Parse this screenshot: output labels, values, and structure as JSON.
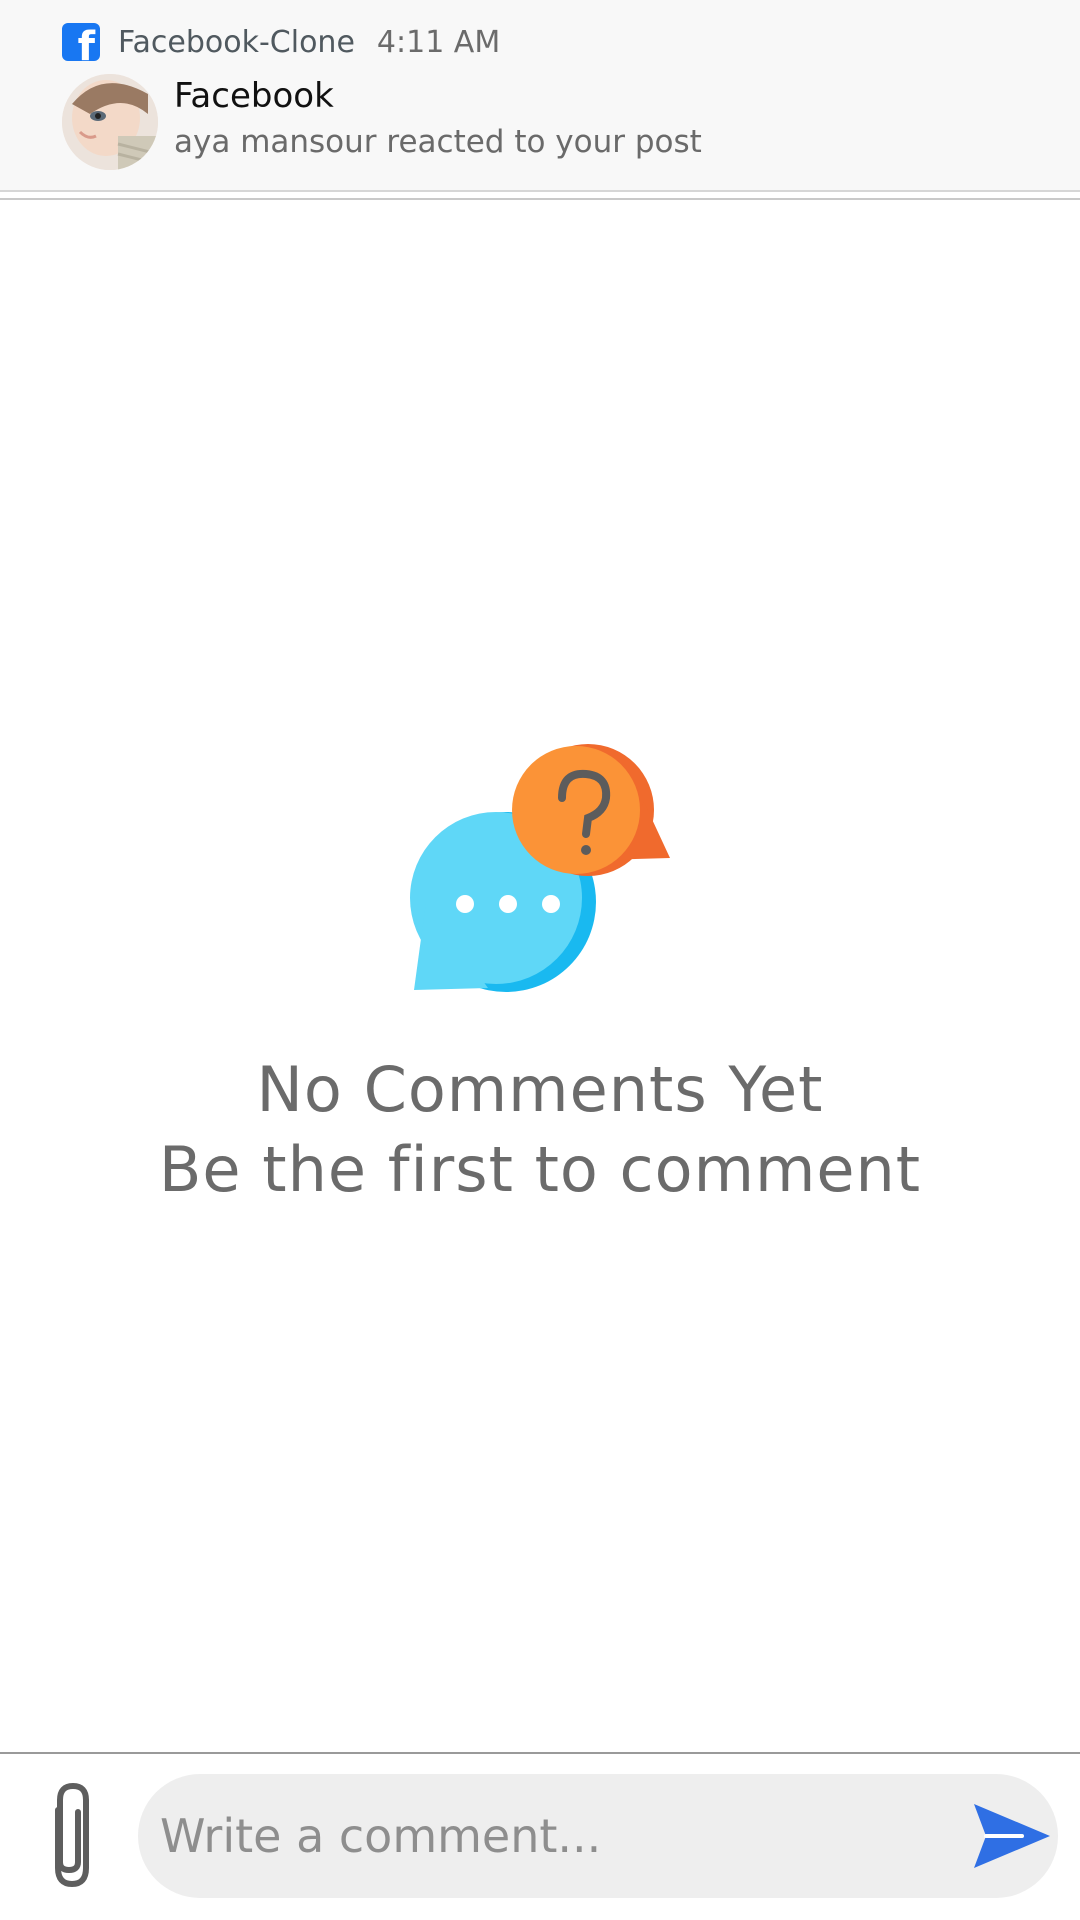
{
  "notification": {
    "app_name": "Facebook-Clone",
    "time": "4:11 AM",
    "title": "Facebook",
    "body": "aya mansour reacted to your post",
    "app_icon": "facebook-icon",
    "fb_letter": "f",
    "brand_color": "#1877f2"
  },
  "empty_state": {
    "title": "No Comments Yet",
    "subtitle": "Be the first to comment",
    "illustration": "chat-bubbles-icon",
    "colors": {
      "blue_bubble": "#5fd7f7",
      "blue_shade": "#19b9f0",
      "orange_bubble": "#fb9337",
      "orange_shade": "#f06a2d"
    }
  },
  "composer": {
    "placeholder": "Write a comment...",
    "value": "",
    "attach_icon": "paperclip-icon",
    "send_icon": "send-icon",
    "send_color": "#2f6fe4"
  }
}
